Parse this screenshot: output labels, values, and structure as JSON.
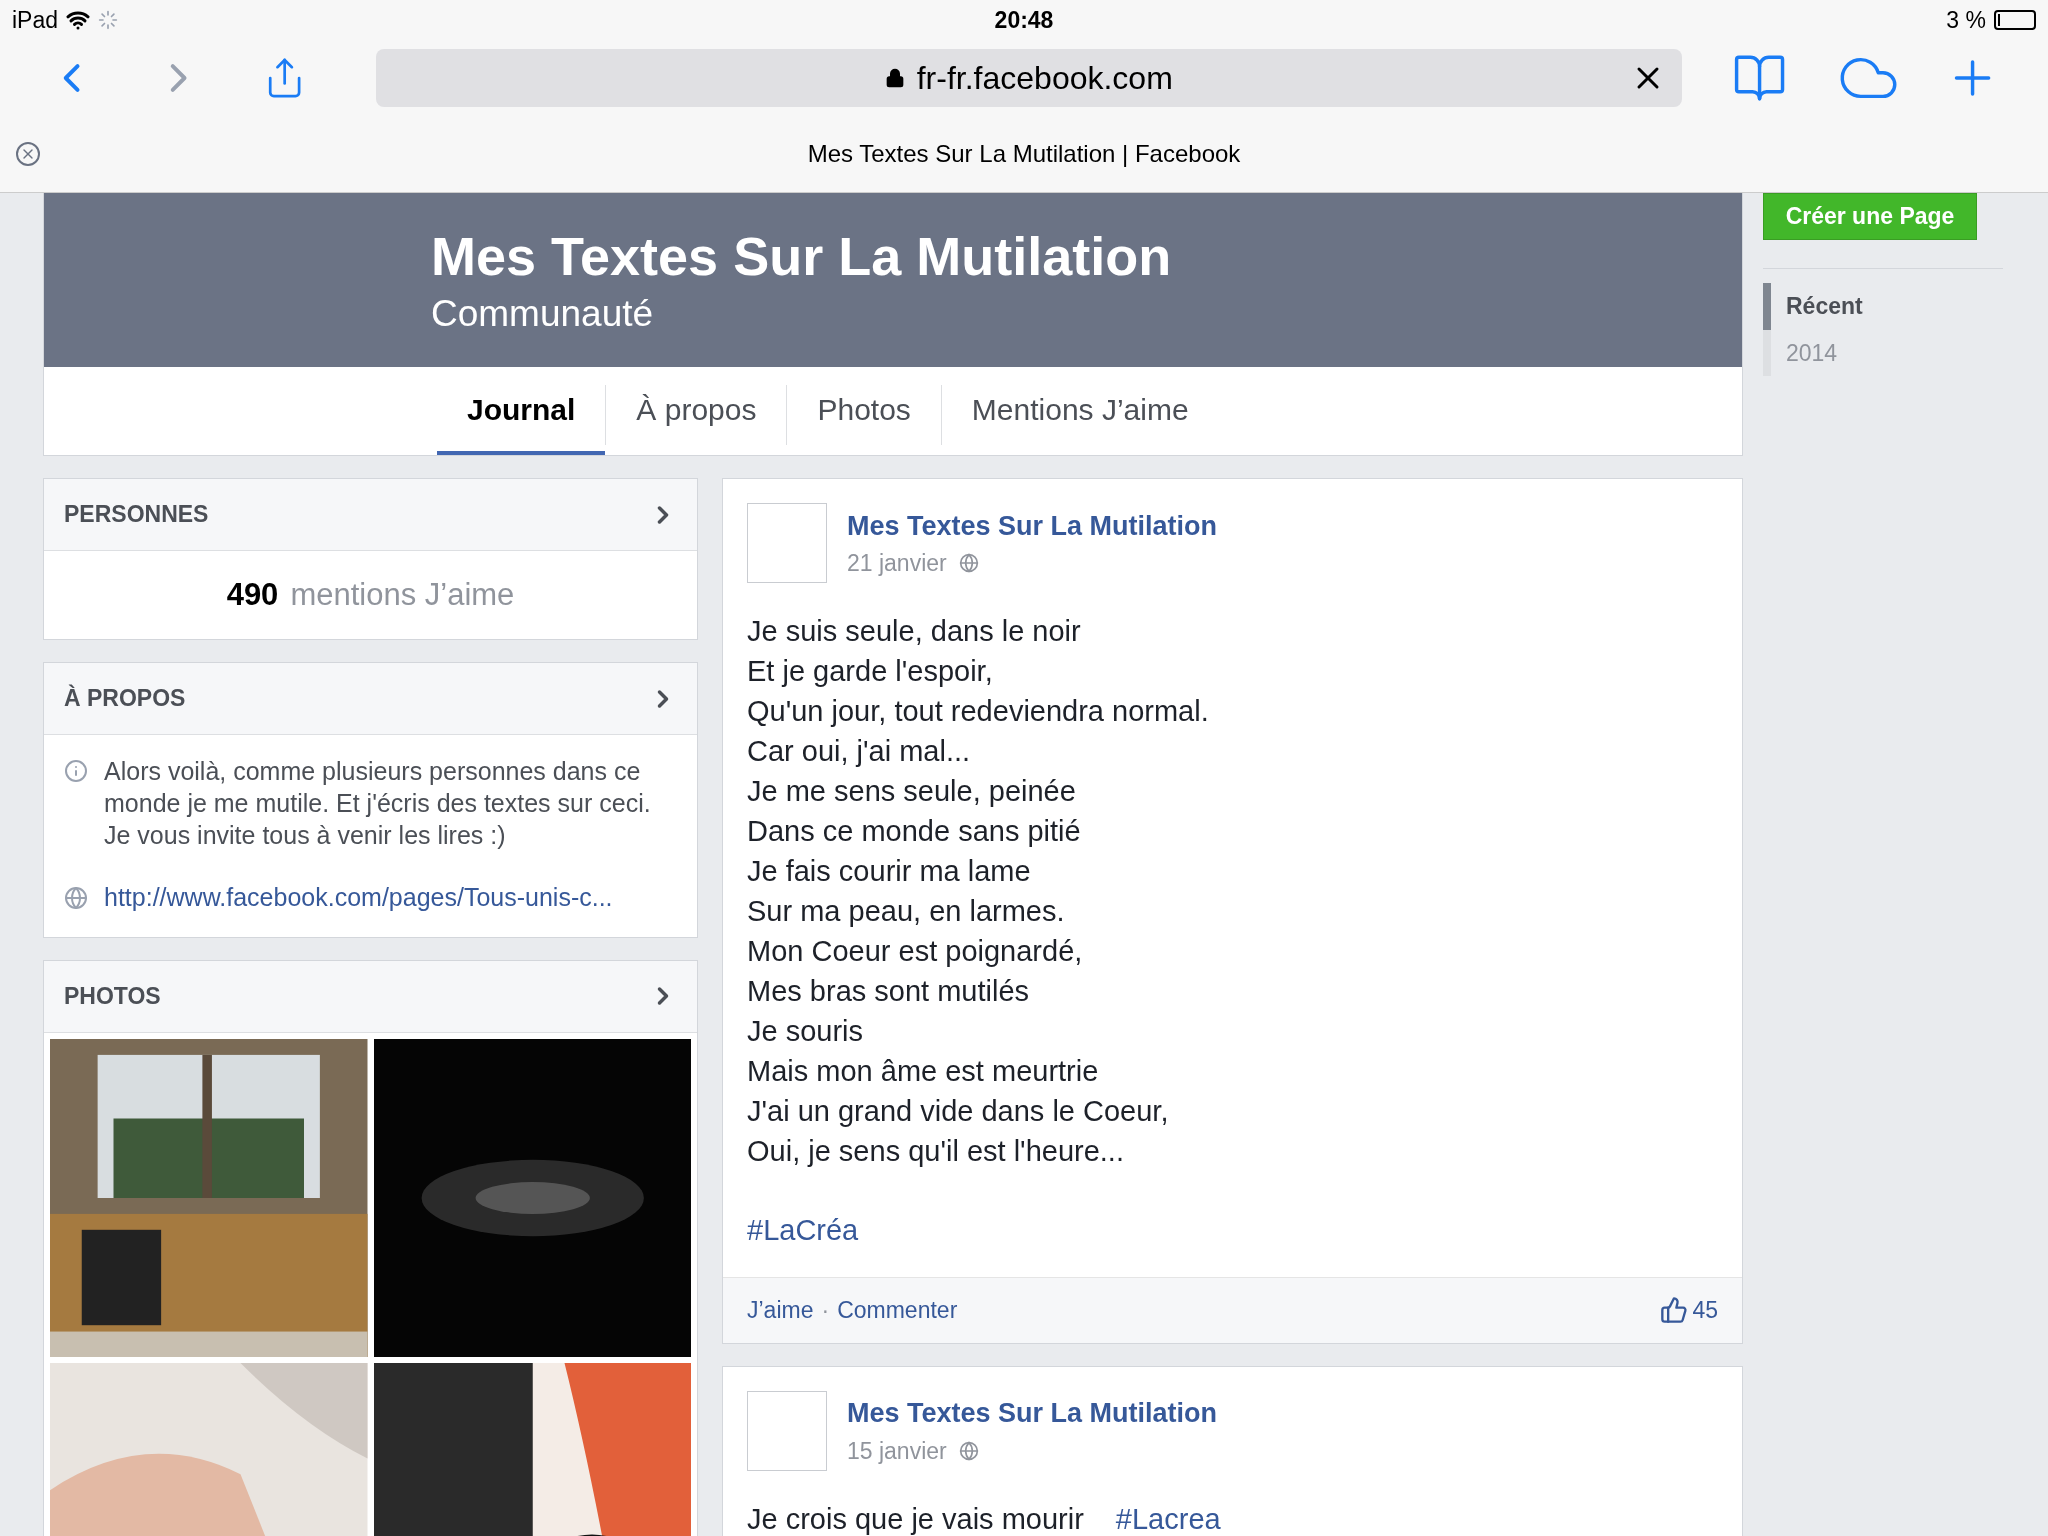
{
  "status_bar": {
    "device": "iPad",
    "time": "20:48",
    "battery": "3 %"
  },
  "browser": {
    "url": "fr-fr.facebook.com",
    "tab_title": "Mes Textes Sur La Mutilation | Facebook"
  },
  "page": {
    "name": "Mes Textes Sur La Mutilation",
    "category": "Communauté",
    "tabs": [
      {
        "label": "Journal",
        "selected": true
      },
      {
        "label": "À propos",
        "selected": false
      },
      {
        "label": "Photos",
        "selected": false
      },
      {
        "label": "Mentions J’aime",
        "selected": false
      }
    ]
  },
  "sidebar": {
    "create_button": "Créer une Page",
    "timeline": [
      {
        "label": "Récent",
        "selected": true
      },
      {
        "label": "2014",
        "selected": false
      }
    ]
  },
  "people": {
    "title": "PERSONNES",
    "count": "490",
    "label": "mentions J’aime"
  },
  "about": {
    "title": "À PROPOS",
    "description": "Alors voilà, comme plusieurs personnes dans ce monde je me mutile. Et j'écris des textes sur ceci. Je vous invite tous à venir les lires :)",
    "link": "http://www.facebook.com/pages/Tous-unis-c..."
  },
  "photos": {
    "title": "PHOTOS"
  },
  "posts": [
    {
      "author": "Mes Textes Sur La Mutilation",
      "date": "21 janvier",
      "lines": [
        "Je suis seule, dans le noir",
        "Et je garde l'espoir,",
        "Qu'un jour, tout redeviendra normal.",
        "Car oui, j'ai mal...",
        "Je me sens seule, peinée",
        "Dans ce monde sans pitié",
        "Je fais courir ma lame",
        "Sur ma peau, en larmes.",
        "Mon Coeur est poignardé,",
        "Mes bras sont mutilés",
        "Je souris",
        "Mais mon âme est meurtrie",
        "J'ai un grand vide dans le Coeur,",
        "Oui, je sens qu'il est l'heure..."
      ],
      "hashtag": "#LaCréa",
      "actions": [
        "J’aime",
        "Commenter"
      ],
      "separator": "·",
      "likes": "45"
    },
    {
      "author": "Mes Textes Sur La Mutilation",
      "date": "15 janvier",
      "lines": [
        "Je crois que je vais mourir"
      ],
      "hashtag": "#Lacrea"
    }
  ]
}
